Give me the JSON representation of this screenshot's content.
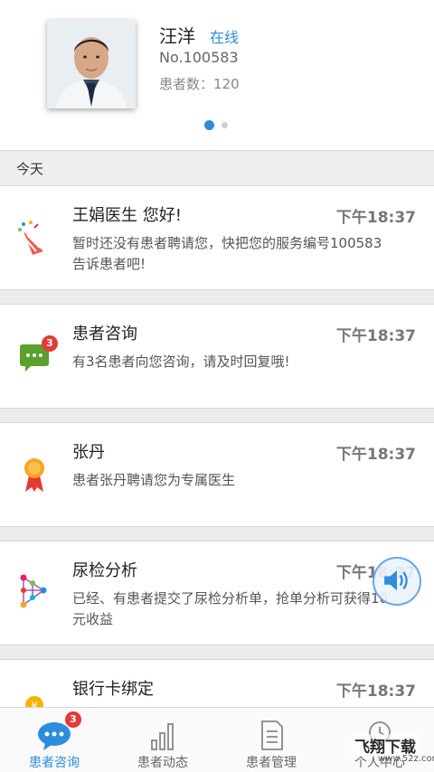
{
  "profile": {
    "name": "汪洋",
    "status": "在线",
    "number": "No.100583",
    "patients": "患者数：120"
  },
  "section": {
    "today": "今天"
  },
  "cards": [
    {
      "title": "王娟医生 您好!",
      "time": "下午18:37",
      "body": "暂时还没有患者聘请您，快把您的服务编号100583告诉患者吧!",
      "icon": "party-popper-icon"
    },
    {
      "title": "患者咨询",
      "time": "下午18:37",
      "body": "有3名患者向您咨询，请及时回复哦!",
      "icon": "chat-bubble-icon",
      "badge": "3"
    },
    {
      "title": "张丹",
      "time": "下午18:37",
      "body": "患者张丹聘请您为专属医生",
      "icon": "award-ribbon-icon"
    },
    {
      "title": "尿检分析",
      "time": "下午18:37",
      "body": "已经、有患者提交了尿检分析单，抢单分析可获得10元收益",
      "icon": "molecule-icon"
    },
    {
      "title": "银行卡绑定",
      "time": "下午18:37",
      "icon": "coin-icon"
    }
  ],
  "tabs": [
    {
      "label": "患者咨询",
      "icon": "chat-icon",
      "badge": "3",
      "active": true
    },
    {
      "label": "患者动态",
      "icon": "bar-chart-icon"
    },
    {
      "label": "患者管理",
      "icon": "document-icon"
    },
    {
      "label": "个人中心",
      "icon": "clock-icon"
    }
  ],
  "watermark": {
    "text": "飞翔下载",
    "url": "www.52z.com"
  },
  "colors": {
    "accent": "#2d8ddc",
    "badge": "#e53935"
  }
}
